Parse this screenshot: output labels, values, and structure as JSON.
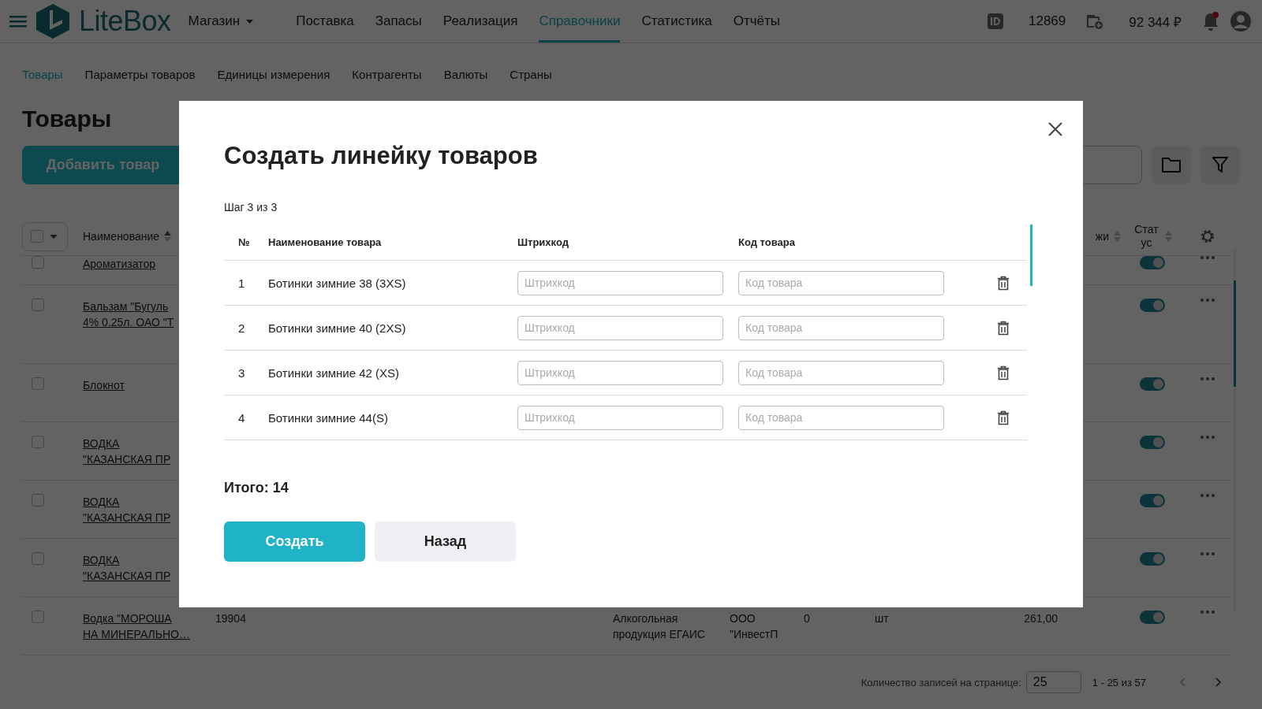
{
  "topbar": {
    "brand": "LiteBox",
    "store": "Магазин",
    "nav": [
      {
        "label": "Поставка",
        "selected": false
      },
      {
        "label": "Запасы",
        "selected": false
      },
      {
        "label": "Реализация",
        "selected": false
      },
      {
        "label": "Справочники",
        "selected": true
      },
      {
        "label": "Статистика",
        "selected": false
      },
      {
        "label": "Отчёты",
        "selected": false
      }
    ],
    "account_id": "12869",
    "balance": "92 344 ₽",
    "has_notification": true
  },
  "subnav": [
    {
      "label": "Товары",
      "selected": true
    },
    {
      "label": "Параметры товаров",
      "selected": false
    },
    {
      "label": "Единицы измерения",
      "selected": false
    },
    {
      "label": "Контрагенты",
      "selected": false
    },
    {
      "label": "Валюты",
      "selected": false
    },
    {
      "label": "Страны",
      "selected": false
    }
  ],
  "page": {
    "title": "Товары",
    "add_button": "Добавить товар"
  },
  "table": {
    "columns": {
      "name": "Наименование",
      "column_8": "жи",
      "status": "Статус"
    },
    "rows": [
      {
        "name": [
          "Ароматизатор"
        ],
        "checked": false,
        "on": true
      },
      {
        "name": [
          "Бальзам \"Бугуль",
          "4% 0.25л. ОАО \"Т"
        ],
        "checked": false,
        "on": true
      },
      {
        "name": [
          "Блокнот"
        ],
        "checked": false,
        "on": true
      },
      {
        "name": [
          "ВОДКА",
          "\"КАЗАНСКАЯ ПР"
        ],
        "checked": false,
        "on": true
      },
      {
        "name": [
          "ВОДКА",
          "\"КАЗАНСКАЯ ПР"
        ],
        "checked": false,
        "on": true
      },
      {
        "name": [
          "ВОДКА",
          "\"КАЗАНСКАЯ ПР"
        ],
        "checked": false,
        "on": true
      },
      {
        "name": [
          "Водка \"МОРОША",
          "НА МИНЕРАЛЬНО…"
        ],
        "checked": false,
        "on": true,
        "code": "19904",
        "category": "Алкогольная продукция ЕГАИС",
        "supplier": "ООО \"ИнвестП",
        "quantity": "0",
        "unit": "шт",
        "price": "261,00"
      }
    ]
  },
  "pagination": {
    "per_page_label": "Количество записей на странице:",
    "per_page": "25",
    "range": "1 - 25 из 57"
  },
  "modal": {
    "title": "Создать линейку товаров",
    "step": "Шаг 3 из 3",
    "columns": [
      "№",
      "Наименование товара",
      "Штрихкод",
      "Код товара"
    ],
    "rows": [
      {
        "number": "1",
        "name": "Ботинки зимние 38 (3XS)",
        "barcode_placeholder": "Штрихкод",
        "code_placeholder": "Код товара"
      },
      {
        "number": "2",
        "name": "Ботинки зимние 40 (2XS)",
        "barcode_placeholder": "Штрихкод",
        "code_placeholder": "Код товара"
      },
      {
        "number": "3",
        "name": "Ботинки зимние 42 (XS)",
        "barcode_placeholder": "Штрихкод",
        "code_placeholder": "Код товара"
      },
      {
        "number": "4",
        "name": "Ботинки зимние 44(S)",
        "barcode_placeholder": "Штрихкод",
        "code_placeholder": "Код товара"
      }
    ],
    "total": "Итого: 14",
    "buttons": [
      {
        "label": "Создать",
        "kind": "primary"
      },
      {
        "label": "Назад",
        "kind": "secondary"
      }
    ]
  }
}
